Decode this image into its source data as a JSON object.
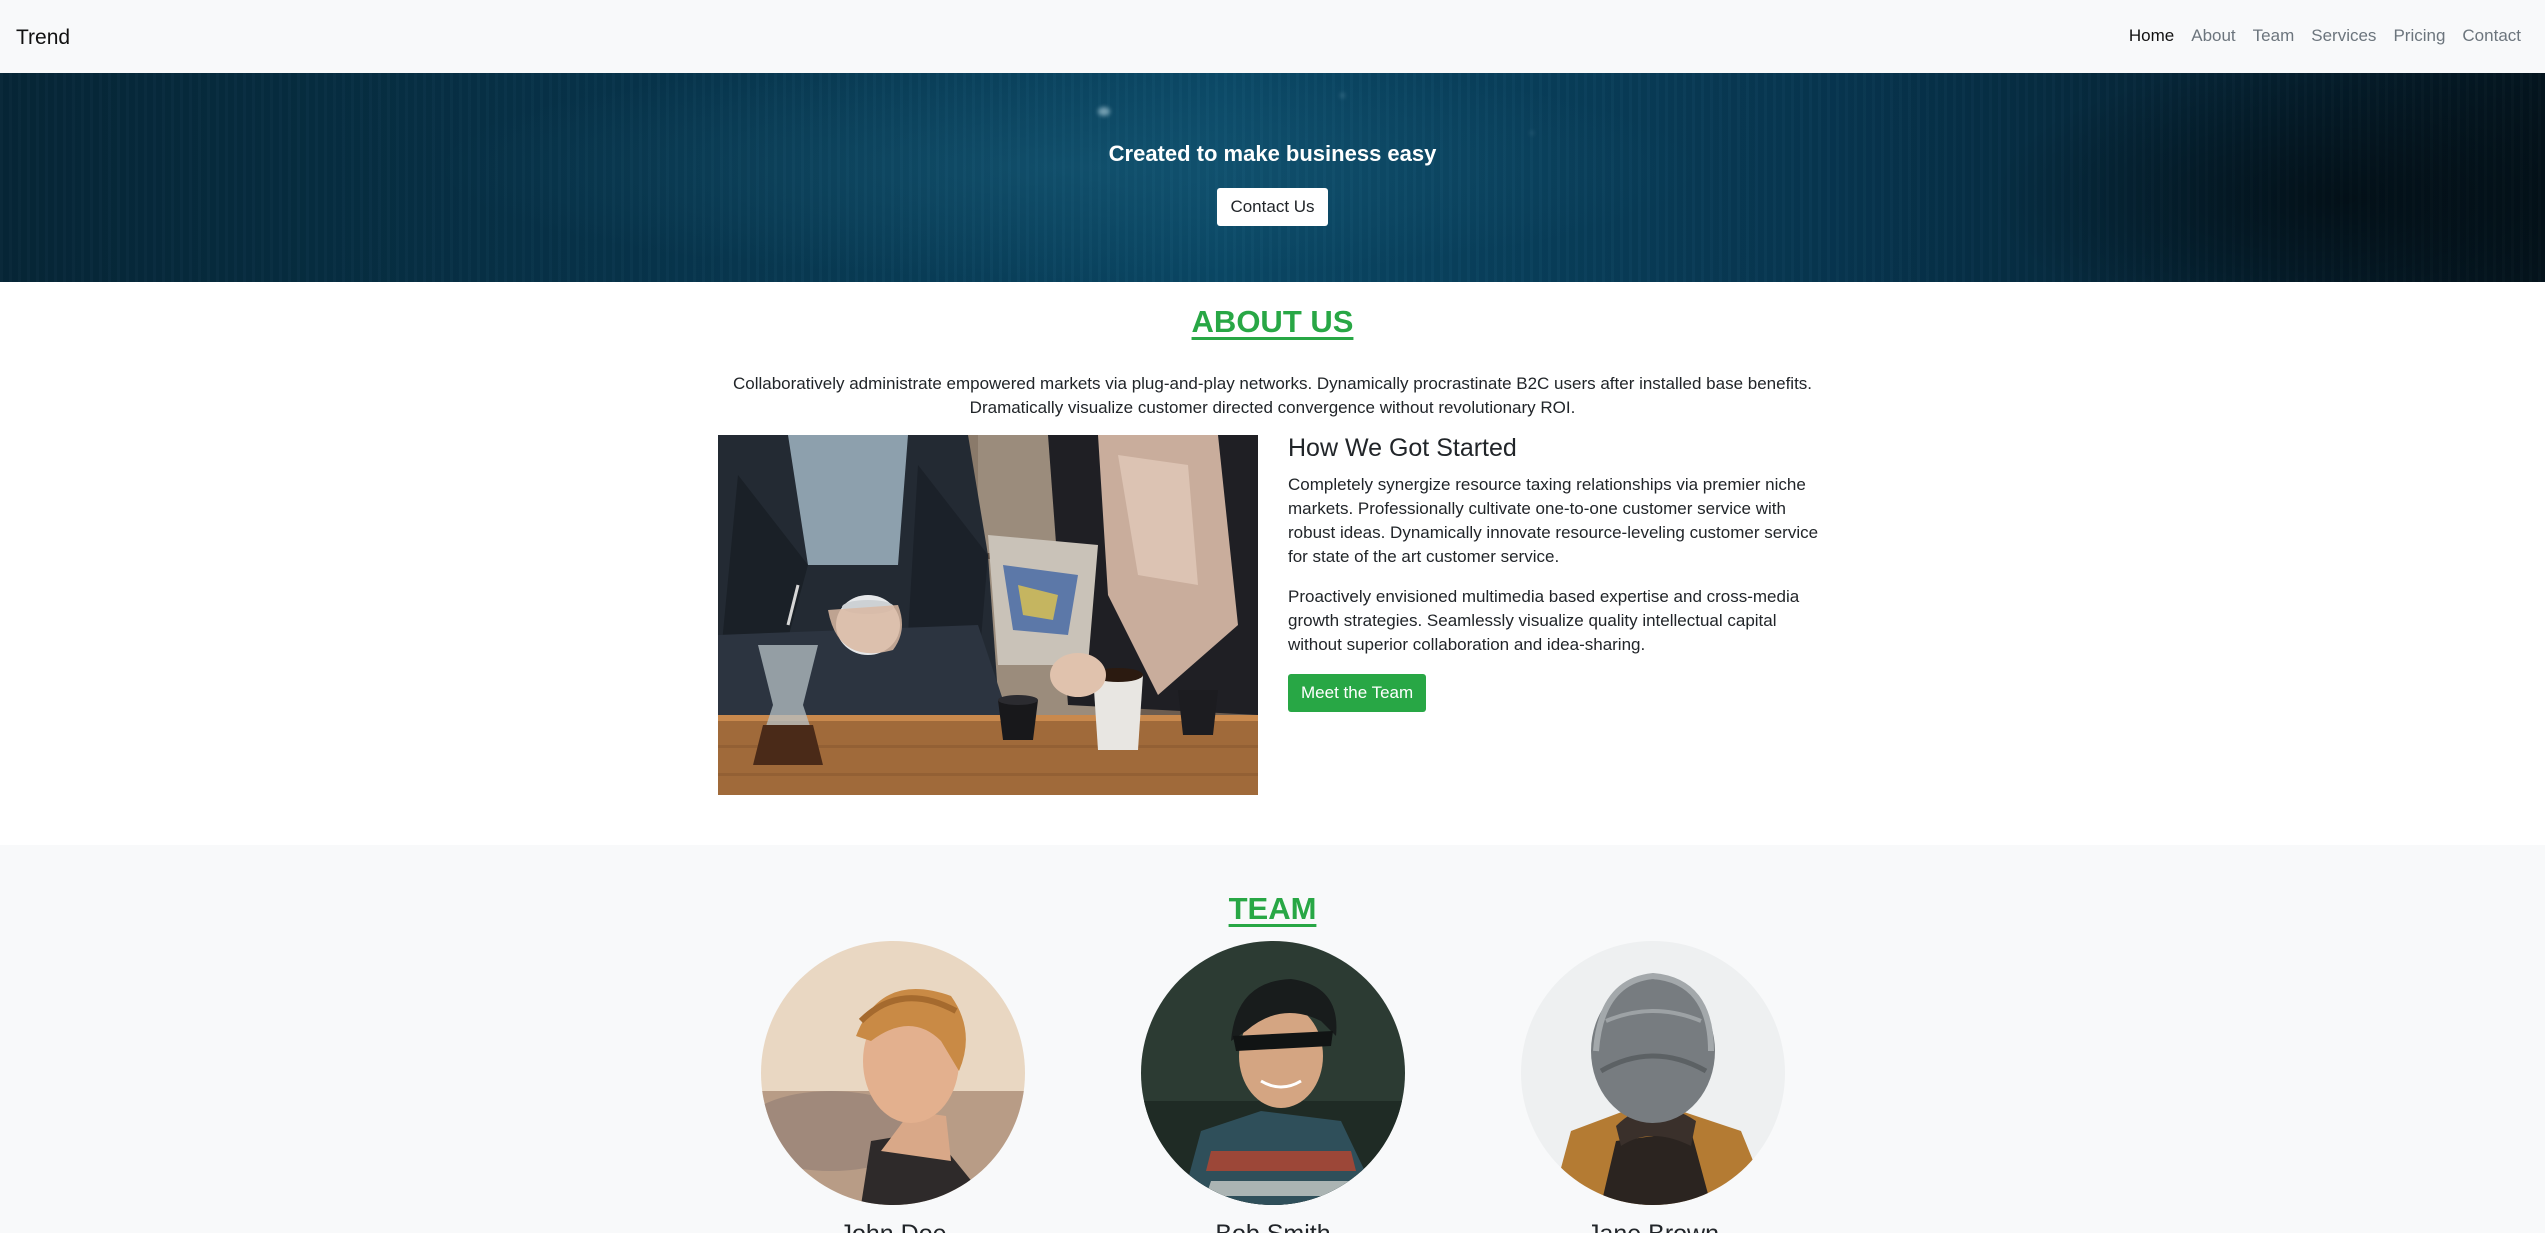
{
  "navbar": {
    "brand": "Trend",
    "links": [
      "Home",
      "About",
      "Team",
      "Services",
      "Pricing",
      "Contact"
    ],
    "active": "Home"
  },
  "hero": {
    "title": "Created to make business easy",
    "button_label": "Contact Us"
  },
  "about": {
    "title": "ABOUT US",
    "lead": "Collaboratively administrate empowered markets via plug-and-play networks. Dynamically procrastinate B2C users after installed base benefits. Dramatically visualize customer directed convergence without revolutionary ROI.",
    "heading": "How We Got Started",
    "paragraph1": "Completely synergize resource taxing relationships via premier niche markets. Professionally cultivate one-to-one customer service with robust ideas. Dynamically innovate resource-leveling customer service for state of the art customer service.",
    "paragraph2": "Proactively envisioned multimedia based expertise and cross-media growth strategies. Seamlessly visualize quality intellectual capital without superior collaboration and idea-sharing.",
    "button_label": "Meet the Team"
  },
  "team": {
    "title": "TEAM",
    "members": [
      {
        "name": "John Doe"
      },
      {
        "name": "Bob Smith"
      },
      {
        "name": "Jane Brown"
      }
    ]
  },
  "colors": {
    "accent": "#28a745",
    "navbar_bg": "#f8f9fa",
    "hero_bg": "#07344b"
  }
}
